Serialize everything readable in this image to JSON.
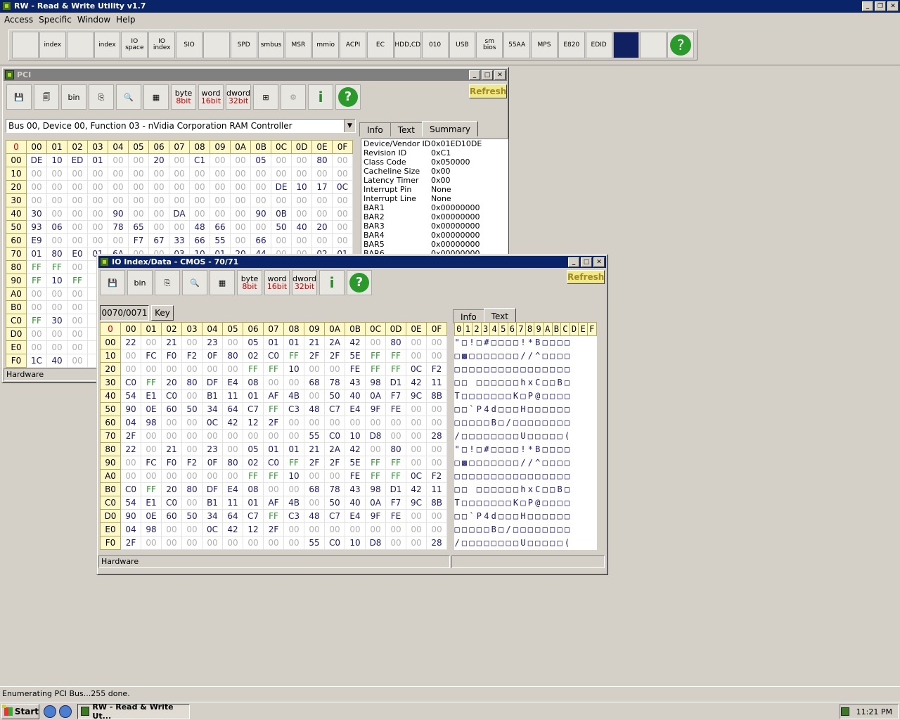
{
  "app": {
    "title": "RW - Read & Write Utility v1.7"
  },
  "menu": [
    "Access",
    "Specific",
    "Window",
    "Help"
  ],
  "toolbar": [
    {
      "name": "pci",
      "l1": "",
      "l2": ""
    },
    {
      "name": "index-pci",
      "l1": "index",
      "l2": ""
    },
    {
      "name": "memory",
      "l1": "",
      "l2": ""
    },
    {
      "name": "index-memory",
      "l1": "index",
      "l2": ""
    },
    {
      "name": "io-space",
      "l1": "IO",
      "l2": "space"
    },
    {
      "name": "io-index",
      "l1": "IO",
      "l2": "index"
    },
    {
      "name": "sio",
      "l1": "SIO",
      "l2": ""
    },
    {
      "name": "scope",
      "l1": "",
      "l2": ""
    },
    {
      "name": "spd",
      "l1": "SPD",
      "l2": ""
    },
    {
      "name": "smbus",
      "l1": "",
      "l2": "smbus"
    },
    {
      "name": "msr",
      "l1": "",
      "l2": "MSR"
    },
    {
      "name": "mmio",
      "l1": "",
      "l2": "mmio"
    },
    {
      "name": "acpi",
      "l1": "",
      "l2": "ACPI"
    },
    {
      "name": "ec",
      "l1": "EC",
      "l2": ""
    },
    {
      "name": "hdd-cd",
      "l1": "",
      "l2": "HDD,CD"
    },
    {
      "name": "disk",
      "l1": "010",
      "l2": ""
    },
    {
      "name": "usb",
      "l1": "",
      "l2": "USB"
    },
    {
      "name": "smbios",
      "l1": "sm",
      "l2": "bios"
    },
    {
      "name": "55aa",
      "l1": "55AA",
      "l2": ""
    },
    {
      "name": "mps",
      "l1": "MPS",
      "l2": ""
    },
    {
      "name": "e820",
      "l1": "E820",
      "l2": ""
    },
    {
      "name": "edid",
      "l1": "EDID",
      "l2": ""
    },
    {
      "name": "command",
      "l1": "",
      "l2": ""
    },
    {
      "name": "tools",
      "l1": "",
      "l2": ""
    },
    {
      "name": "help",
      "l1": "?",
      "l2": ""
    }
  ],
  "pci": {
    "title": "PCI",
    "refresh": "Refresh",
    "device": "Bus 00, Device 00, Function 03 - nVidia Corporation RAM Controller",
    "tabs": [
      "Info",
      "Text",
      "Summary"
    ],
    "col_headers": [
      "0",
      "00",
      "01",
      "02",
      "03",
      "04",
      "05",
      "06",
      "07",
      "08",
      "09",
      "0A",
      "0B",
      "0C",
      "0D",
      "0E",
      "0F"
    ],
    "rows": [
      [
        "00",
        [
          "DE",
          "10",
          "ED",
          "01",
          "00",
          "00",
          "20",
          "00",
          "C1",
          "00",
          "00",
          "05",
          "00",
          "00",
          "80",
          "00"
        ]
      ],
      [
        "10",
        [
          "00",
          "00",
          "00",
          "00",
          "00",
          "00",
          "00",
          "00",
          "00",
          "00",
          "00",
          "00",
          "00",
          "00",
          "00",
          "00"
        ]
      ],
      [
        "20",
        [
          "00",
          "00",
          "00",
          "00",
          "00",
          "00",
          "00",
          "00",
          "00",
          "00",
          "00",
          "00",
          "DE",
          "10",
          "17",
          "0C"
        ]
      ],
      [
        "30",
        [
          "00",
          "00",
          "00",
          "00",
          "00",
          "00",
          "00",
          "00",
          "00",
          "00",
          "00",
          "00",
          "00",
          "00",
          "00",
          "00"
        ]
      ],
      [
        "40",
        [
          "30",
          "00",
          "00",
          "00",
          "90",
          "00",
          "00",
          "DA",
          "00",
          "00",
          "00",
          "90",
          "0B",
          "00",
          "00",
          "00"
        ]
      ],
      [
        "50",
        [
          "93",
          "06",
          "00",
          "00",
          "78",
          "65",
          "00",
          "00",
          "48",
          "66",
          "00",
          "00",
          "50",
          "40",
          "20",
          "00"
        ]
      ],
      [
        "60",
        [
          "E9",
          "00",
          "00",
          "00",
          "00",
          "F7",
          "67",
          "33",
          "66",
          "55",
          "00",
          "66",
          "00",
          "00",
          "00",
          "00"
        ]
      ],
      [
        "70",
        [
          "01",
          "80",
          "E0",
          "01",
          "6A",
          "00",
          "00",
          "03",
          "10",
          "01",
          "20",
          "44",
          "00",
          "00",
          "02",
          "01"
        ]
      ],
      [
        "80",
        [
          "FF",
          "FF",
          "00",
          "",
          "",
          "",
          "",
          "",
          "",
          "",
          "",
          "",
          "",
          "",
          "",
          ""
        ]
      ],
      [
        "90",
        [
          "FF",
          "10",
          "FF",
          "",
          "",
          "",
          "",
          "",
          "",
          "",
          "",
          "",
          "",
          "",
          "",
          ""
        ]
      ],
      [
        "A0",
        [
          "00",
          "00",
          "00",
          "",
          "",
          "",
          "",
          "",
          "",
          "",
          "",
          "",
          "",
          "",
          "",
          ""
        ]
      ],
      [
        "B0",
        [
          "00",
          "00",
          "00",
          "",
          "",
          "",
          "",
          "",
          "",
          "",
          "",
          "",
          "",
          "",
          "",
          ""
        ]
      ],
      [
        "C0",
        [
          "FF",
          "30",
          "00",
          "",
          "",
          "",
          "",
          "",
          "",
          "",
          "",
          "",
          "",
          "",
          "",
          ""
        ]
      ],
      [
        "D0",
        [
          "00",
          "00",
          "00",
          "",
          "",
          "",
          "",
          "",
          "",
          "",
          "",
          "",
          "",
          "",
          "",
          ""
        ]
      ],
      [
        "E0",
        [
          "00",
          "00",
          "00",
          "",
          "",
          "",
          "",
          "",
          "",
          "",
          "",
          "",
          "",
          "",
          "",
          ""
        ]
      ],
      [
        "F0",
        [
          "1C",
          "40",
          "00",
          "",
          "",
          "",
          "",
          "",
          "",
          "",
          "",
          "",
          "",
          "",
          "",
          ""
        ]
      ]
    ],
    "summary": [
      [
        "Device/Vendor ID",
        "0x01ED10DE"
      ],
      [
        "Revision ID",
        "0xC1"
      ],
      [
        "Class Code",
        "0x050000"
      ],
      [
        "Cacheline Size",
        "0x00"
      ],
      [
        "Latency Timer",
        "0x00"
      ],
      [
        "Interrupt Pin",
        "None"
      ],
      [
        "Interrupt Line",
        "None"
      ],
      [
        "BAR1",
        "0x00000000"
      ],
      [
        "BAR2",
        "0x00000000"
      ],
      [
        "BAR3",
        "0x00000000"
      ],
      [
        "BAR4",
        "0x00000000"
      ],
      [
        "BAR5",
        "0x00000000"
      ],
      [
        "BAR6",
        "0x00000000"
      ]
    ],
    "status": "Hardware"
  },
  "cmos": {
    "title": "IO Index/Data - CMOS - 70/71",
    "refresh": "Refresh",
    "address": "0070/0071",
    "key": "Key",
    "tabs": [
      "Info",
      "Text"
    ],
    "col_headers": [
      "0",
      "00",
      "01",
      "02",
      "03",
      "04",
      "05",
      "06",
      "07",
      "08",
      "09",
      "0A",
      "0B",
      "0C",
      "0D",
      "0E",
      "0F"
    ],
    "text_headers": [
      "0",
      "1",
      "2",
      "3",
      "4",
      "5",
      "6",
      "7",
      "8",
      "9",
      "A",
      "B",
      "C",
      "D",
      "E",
      "F"
    ],
    "rows": [
      [
        "00",
        [
          "22",
          "00",
          "21",
          "00",
          "23",
          "00",
          "05",
          "01",
          "01",
          "21",
          "2A",
          "42",
          "00",
          "80",
          "00",
          "00"
        ]
      ],
      [
        "10",
        [
          "00",
          "FC",
          "F0",
          "F2",
          "0F",
          "80",
          "02",
          "C0",
          "FF",
          "2F",
          "2F",
          "5E",
          "FF",
          "FF",
          "00",
          "00"
        ]
      ],
      [
        "20",
        [
          "00",
          "00",
          "00",
          "00",
          "00",
          "00",
          "FF",
          "FF",
          "10",
          "00",
          "00",
          "FE",
          "FF",
          "FF",
          "0C",
          "F2"
        ]
      ],
      [
        "30",
        [
          "C0",
          "FF",
          "20",
          "80",
          "DF",
          "E4",
          "08",
          "00",
          "00",
          "68",
          "78",
          "43",
          "98",
          "D1",
          "42",
          "11"
        ]
      ],
      [
        "40",
        [
          "54",
          "E1",
          "C0",
          "00",
          "B1",
          "11",
          "01",
          "AF",
          "4B",
          "00",
          "50",
          "40",
          "0A",
          "F7",
          "9C",
          "8B"
        ]
      ],
      [
        "50",
        [
          "90",
          "0E",
          "60",
          "50",
          "34",
          "64",
          "C7",
          "FF",
          "C3",
          "48",
          "C7",
          "E4",
          "9F",
          "FE",
          "00",
          "00"
        ]
      ],
      [
        "60",
        [
          "04",
          "98",
          "00",
          "00",
          "0C",
          "42",
          "12",
          "2F",
          "00",
          "00",
          "00",
          "00",
          "00",
          "00",
          "00",
          "00"
        ]
      ],
      [
        "70",
        [
          "2F",
          "00",
          "00",
          "00",
          "00",
          "00",
          "00",
          "00",
          "00",
          "55",
          "C0",
          "10",
          "D8",
          "00",
          "00",
          "28"
        ]
      ],
      [
        "80",
        [
          "22",
          "00",
          "21",
          "00",
          "23",
          "00",
          "05",
          "01",
          "01",
          "21",
          "2A",
          "42",
          "00",
          "80",
          "00",
          "00"
        ]
      ],
      [
        "90",
        [
          "00",
          "FC",
          "F0",
          "F2",
          "0F",
          "80",
          "02",
          "C0",
          "FF",
          "2F",
          "2F",
          "5E",
          "FF",
          "FF",
          "00",
          "00"
        ]
      ],
      [
        "A0",
        [
          "00",
          "00",
          "00",
          "00",
          "00",
          "00",
          "FF",
          "FF",
          "10",
          "00",
          "00",
          "FE",
          "FF",
          "FF",
          "0C",
          "F2"
        ]
      ],
      [
        "B0",
        [
          "C0",
          "FF",
          "20",
          "80",
          "DF",
          "E4",
          "08",
          "00",
          "00",
          "68",
          "78",
          "43",
          "98",
          "D1",
          "42",
          "11"
        ]
      ],
      [
        "C0",
        [
          "54",
          "E1",
          "C0",
          "00",
          "B1",
          "11",
          "01",
          "AF",
          "4B",
          "00",
          "50",
          "40",
          "0A",
          "F7",
          "9C",
          "8B"
        ]
      ],
      [
        "D0",
        [
          "90",
          "0E",
          "60",
          "50",
          "34",
          "64",
          "C7",
          "FF",
          "C3",
          "48",
          "C7",
          "E4",
          "9F",
          "FE",
          "00",
          "00"
        ]
      ],
      [
        "E0",
        [
          "04",
          "98",
          "00",
          "00",
          "0C",
          "42",
          "12",
          "2F",
          "00",
          "00",
          "00",
          "00",
          "00",
          "00",
          "00",
          "00"
        ]
      ],
      [
        "F0",
        [
          "2F",
          "00",
          "00",
          "00",
          "00",
          "00",
          "00",
          "00",
          "00",
          "55",
          "C0",
          "10",
          "D8",
          "00",
          "00",
          "28"
        ]
      ]
    ],
    "text_rows": [
      "\"□!□#□□□□!*B□□□□",
      "□▩□□□□□□□//^□□□□",
      "□□□□□□□□□□□□□□□□",
      "□□ □□□□□□hxC□□B□",
      "T□□□□□□□K□P@□□□□",
      "□□`P4d□□□H□□□□□□",
      "□□□□□B□/□□□□□□□□",
      "/□□□□□□□□U□□□□□(",
      "\"□!□#□□□□!*B□□□□",
      "□▩□□□□□□□//^□□□□",
      "□□□□□□□□□□□□□□□□",
      "□□ □□□□□□hxC□□B□",
      "T□□□□□□□K□P@□□□□",
      "□□`P4d□□□H□□□□□□",
      "□□□□□B□/□□□□□□□□",
      "/□□□□□□□□U□□□□□("
    ],
    "status": "Hardware"
  },
  "child_toolbar": {
    "byte": "byte",
    "byte_bits": "8bit",
    "word": "word",
    "word_bits": "16bit",
    "dword": "dword",
    "dword_bits": "32bit",
    "bin": "bin"
  },
  "status": "Enumerating PCI Bus...255 done.",
  "taskbar": {
    "start": "Start",
    "task": "RW - Read & Write Ut...",
    "clock": "11:21 PM"
  }
}
